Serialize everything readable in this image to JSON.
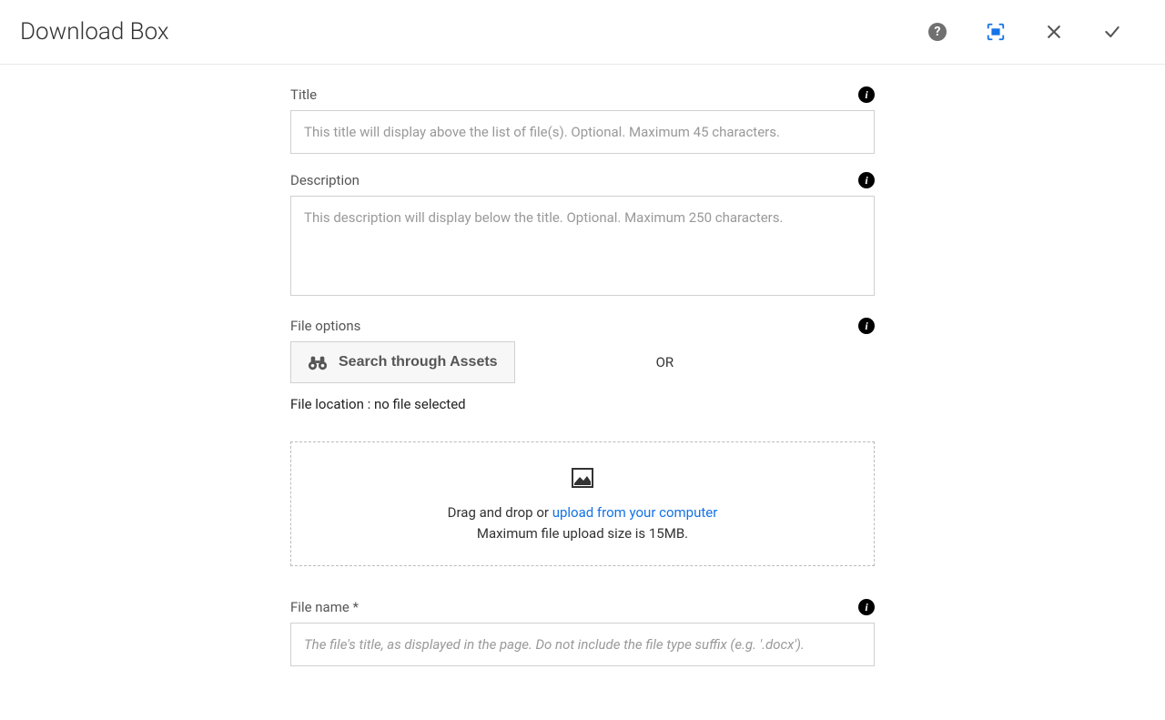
{
  "header": {
    "title": "Download Box"
  },
  "form": {
    "title": {
      "label": "Title",
      "placeholder": "This title will display above the list of file(s). Optional. Maximum 45 characters.",
      "value": ""
    },
    "description": {
      "label": "Description",
      "placeholder": "This description will display below the title. Optional. Maximum 250 characters.",
      "value": ""
    },
    "file_options": {
      "label": "File options",
      "search_btn": "Search through Assets",
      "or_text": "OR",
      "file_location_label": "File location : ",
      "file_location_value": "no file selected"
    },
    "dropzone": {
      "drag_text": "Drag and drop or ",
      "upload_link": "upload from your computer",
      "max_size": "Maximum file upload size is 15MB."
    },
    "file_name": {
      "label": "File name *",
      "placeholder": "The file's title, as displayed in the page. Do not include the file type suffix (e.g. '.docx').",
      "value": ""
    }
  }
}
